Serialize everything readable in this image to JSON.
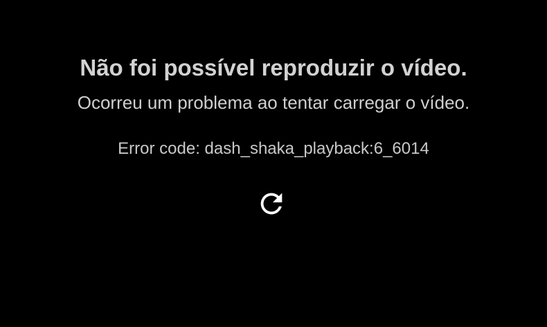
{
  "error": {
    "title": "Não foi possível reproduzir o vídeo.",
    "message": "Ocorreu um problema ao tentar carregar o vídeo.",
    "code_text": "Error code: dash_shaka_playback:6_6014"
  },
  "reload": {
    "icon": "reload-icon"
  },
  "colors": {
    "background": "#000000",
    "text": "#d2d2d2",
    "icon": "#ffffff"
  }
}
